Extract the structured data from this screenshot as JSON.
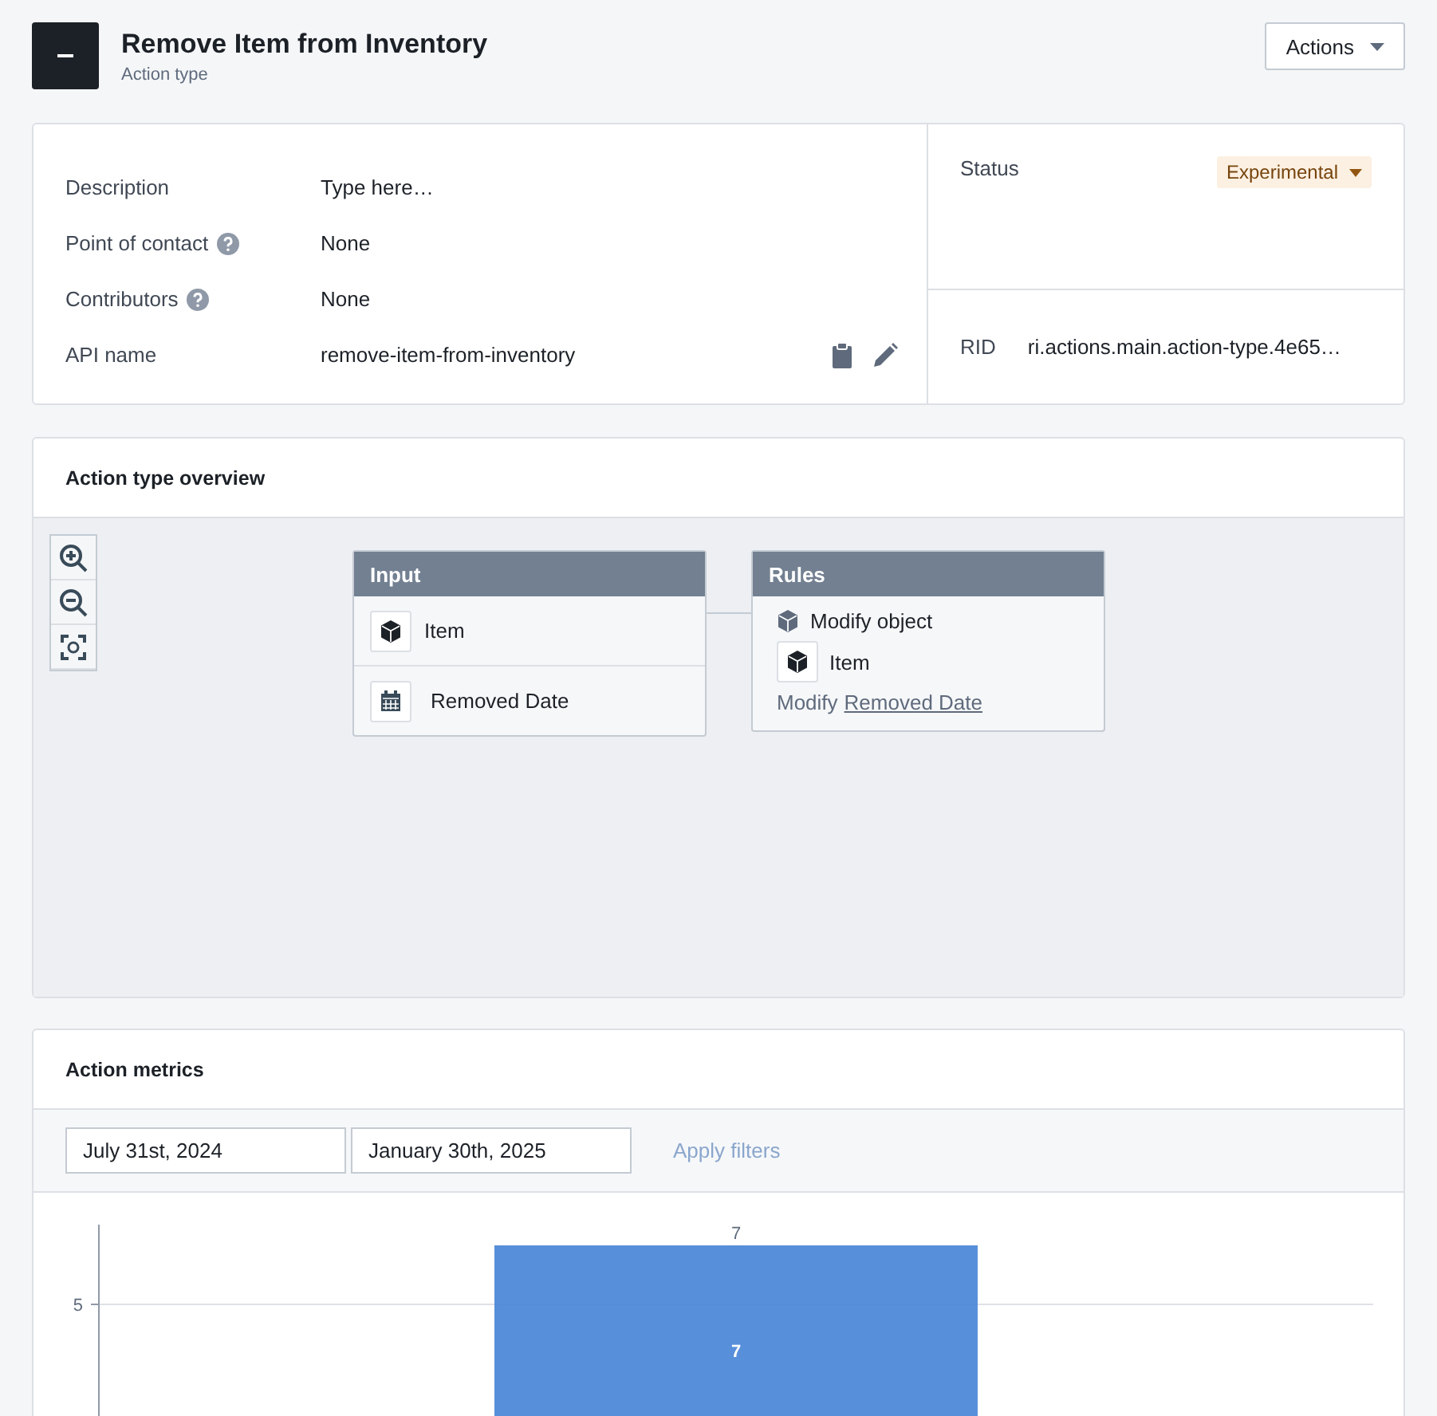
{
  "header": {
    "title": "Remove Item from Inventory",
    "subtitle": "Action type",
    "actions_button": "Actions"
  },
  "details": {
    "fields": [
      {
        "label": "Description",
        "value": "Type here…",
        "help": false,
        "kind": "text"
      },
      {
        "label": "Point of contact",
        "value": "None",
        "help": true,
        "kind": "text"
      },
      {
        "label": "Contributors",
        "value": "None",
        "help": true,
        "kind": "text"
      },
      {
        "label": "API name",
        "value": "remove-item-from-inventory",
        "help": false,
        "kind": "api"
      }
    ],
    "status": {
      "label": "Status",
      "value": "Experimental"
    },
    "rid": {
      "label": "RID",
      "value": "ri.actions.main.action-type.4e65…"
    }
  },
  "overview": {
    "title": "Action type overview",
    "input_node": {
      "title": "Input",
      "rows": [
        {
          "kind": "object",
          "label": "Item"
        },
        {
          "kind": "date",
          "label": "Removed Date"
        }
      ]
    },
    "rules_node": {
      "title": "Rules",
      "rule": "Modify object",
      "object": "Item",
      "modify_prefix": "Modify",
      "modify_link": "Removed Date"
    }
  },
  "metrics": {
    "title": "Action metrics",
    "start_date": "July 31st, 2024",
    "end_date": "January 30th, 2025",
    "apply_button": {
      "label": "Apply filters",
      "disabled": true
    },
    "y_tick_label": "5",
    "bar_top_label": "7",
    "bar_center_label": "7"
  }
}
